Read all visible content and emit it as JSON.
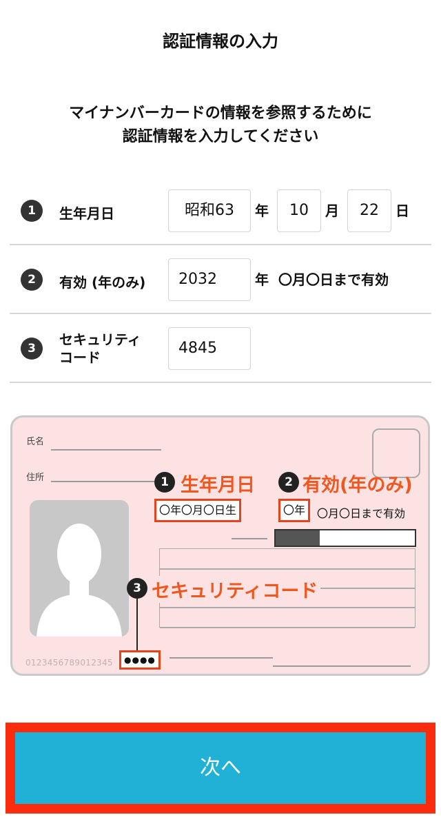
{
  "header": {
    "title": "認証情報の入力"
  },
  "instructions": {
    "line1": "マイナンバーカードの情報を参照するために",
    "line2": "認証情報を入力してください"
  },
  "form": {
    "birthdate": {
      "number": "1",
      "label": "生年月日",
      "era_year": "昭和63",
      "year_unit": "年",
      "month": "10",
      "month_unit": "月",
      "day": "22",
      "day_unit": "日"
    },
    "expiry": {
      "number": "2",
      "label": "有効 (年のみ)",
      "year": "2032",
      "year_unit": "年",
      "suffix": "〇月〇日まで有効"
    },
    "security": {
      "number": "3",
      "label_line1": "セキュリティ",
      "label_line2": "コード",
      "code": "4845"
    }
  },
  "card": {
    "name_label": "氏名",
    "address_label": "住所",
    "callout_birthdate_number": "1",
    "callout_birthdate": "生年月日",
    "callout_expiry_number": "2",
    "callout_expiry": "有効(年のみ)",
    "callout_security_number": "3",
    "callout_security": "セキュリティコード",
    "birthdate_placeholder": "〇年〇月〇日生",
    "expiry_year_placeholder": "〇年",
    "expiry_rest": "〇月〇日まで有効",
    "security_placeholder": "●●●●",
    "card_number": "0123456789012345"
  },
  "colors": {
    "accent_orange": "#f0571e",
    "highlight_border": "#e8421b",
    "button_bg": "#21b1d7",
    "button_frame": "#fb2c0e",
    "card_bg": "#fce2e2"
  },
  "footer": {
    "next_label": "次へ"
  }
}
